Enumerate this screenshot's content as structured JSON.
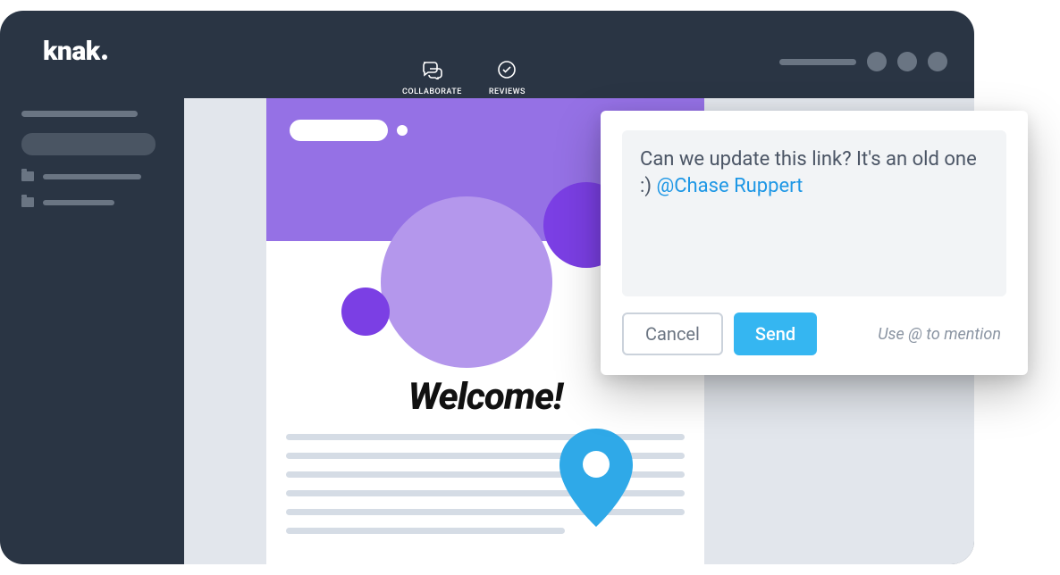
{
  "brand": {
    "name": "knak"
  },
  "tabs": {
    "collaborate": "COLLABORATE",
    "reviews": "REVIEWS"
  },
  "email": {
    "title": "Welcome!"
  },
  "comment": {
    "text_before_mention": "Can we update this link? It's an old one :) ",
    "mention": "@Chase Ruppert",
    "cancel_label": "Cancel",
    "send_label": "Send",
    "hint": "Use @ to mention"
  }
}
